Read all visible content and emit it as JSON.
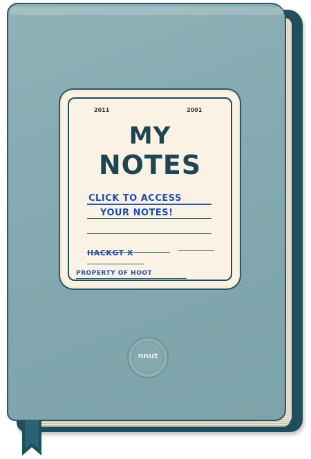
{
  "notebook": {
    "label": {
      "year_left": "2011",
      "year_right": "2001",
      "title_line1": "MY",
      "title_line2": "NOTES",
      "cta_line1": "CLICK TO ACCESS",
      "cta_line2": "YOUR NOTES!",
      "name": "HACKGT X",
      "property": "PROPERTY OF HOOT"
    },
    "emblem_text": "nnut",
    "colors": {
      "cover": "#86a9b0",
      "spine": "#1f4f5c",
      "label_bg": "#fbf2e6",
      "title": "#1d4652",
      "handwriting": "#1a4fb0"
    }
  }
}
